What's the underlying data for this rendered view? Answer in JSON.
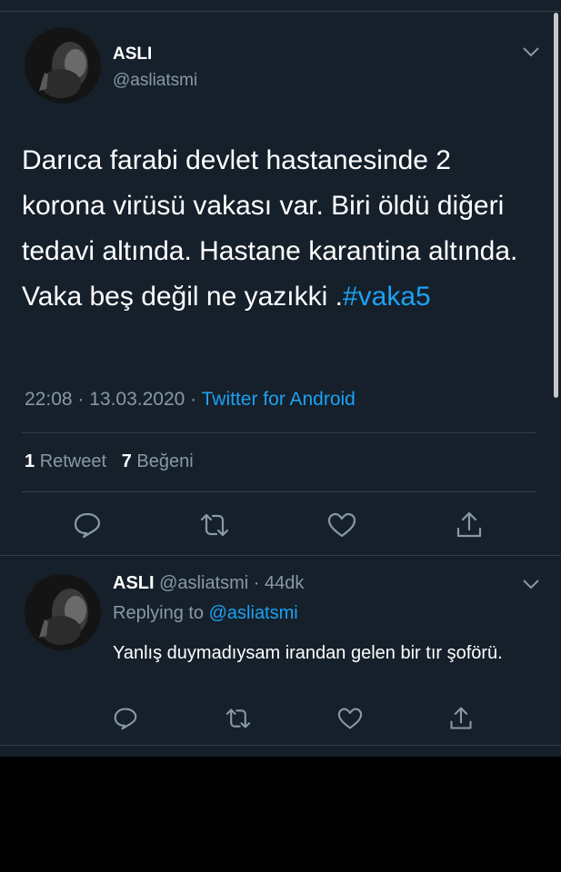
{
  "tweet": {
    "name": "ASLI",
    "handle": "@asliatsmi",
    "text": "Darıca farabi devlet hastanesinde 2 korona virüsü vakası var. Biri öldü diğeri tedavi altında. Hastane karantina altında. Vaka beş değil ne yazıkki .",
    "hashtag": "#vaka5",
    "time": "22:08 · 13.03.2020 ·",
    "source": "Twitter for Android",
    "retweet_count": "1",
    "retweet_label": "Retweet",
    "like_count": "7",
    "like_label": "Beğeni"
  },
  "reply": {
    "name": "ASLI",
    "handle_time": "@asliatsmi · 44dk",
    "replying_label": "Replying to",
    "replying_to": "@asliatsmi",
    "text": "Yanlış duymadıysam irandan gelen bir tır şoförü."
  },
  "icons": [
    "chevron-down-icon",
    "reply-icon",
    "retweet-icon",
    "like-icon",
    "share-icon"
  ],
  "colors": {
    "background": "#15202b",
    "accent": "#1da1f2",
    "secondary_text": "#8899a6",
    "divider": "#2f3d4c"
  }
}
